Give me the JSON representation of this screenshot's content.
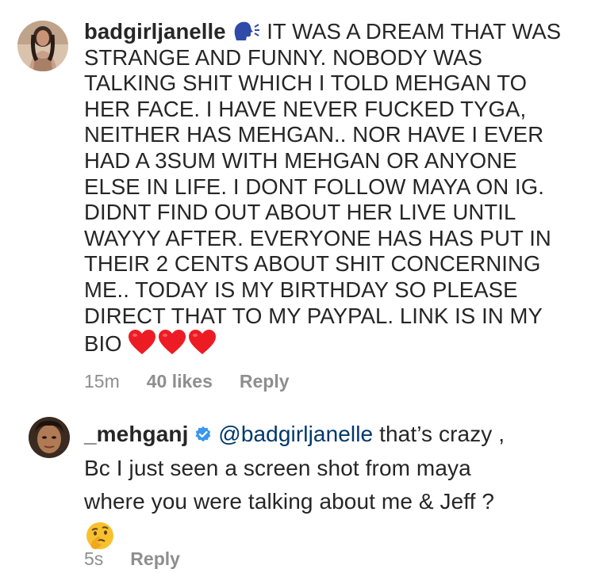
{
  "comments": [
    {
      "username": "badgirljanelle",
      "speaking_emoji": "speaking-head-icon",
      "lines": [
        "IT WAS A DREAM THAT WAS",
        "STRANGE AND FUNNY. NOBODY WAS",
        "TALKING SHIT WHICH I TOLD MEHGAN TO",
        "HER FACE. I HAVE NEVER FUCKED TYGA,",
        "NEITHER HAS MEHGAN.. NOR HAVE I EVER",
        "HAD A 3SUM WITH MEHGAN OR ANYONE",
        "ELSE IN LIFE. I DONT FOLLOW MAYA ON IG.",
        "DIDNT FIND OUT ABOUT HER LIVE UNTIL",
        "WAYYY AFTER. EVERYONE HAS HAS PUT IN",
        "THEIR 2 CENTS ABOUT SHIT CONCERNING",
        "ME.. TODAY IS MY BIRTHDAY SO PLEASE",
        "DIRECT THAT TO MY PAYPAL. LINK IS IN MY",
        "BIO"
      ],
      "trailing_emojis": [
        "heart-icon",
        "heart-icon",
        "heart-icon"
      ],
      "time": "15m",
      "likes": "40 likes",
      "reply": "Reply"
    },
    {
      "username": "_mehganj",
      "verified": true,
      "mention": "@badgirljanelle",
      "first_line_rest": " that’s crazy ,",
      "lines": [
        "Bc I just seen a screen shot from maya",
        "where you were talking about me & Jeff ?"
      ],
      "trailing_emoji": "thinking-face-icon",
      "time": "5s",
      "reply": "Reply"
    }
  ],
  "colors": {
    "text": "#262626",
    "meta": "#8e8e8e",
    "mention": "#00376b",
    "verified": "#3897f0",
    "heart": "#ed1c24"
  }
}
